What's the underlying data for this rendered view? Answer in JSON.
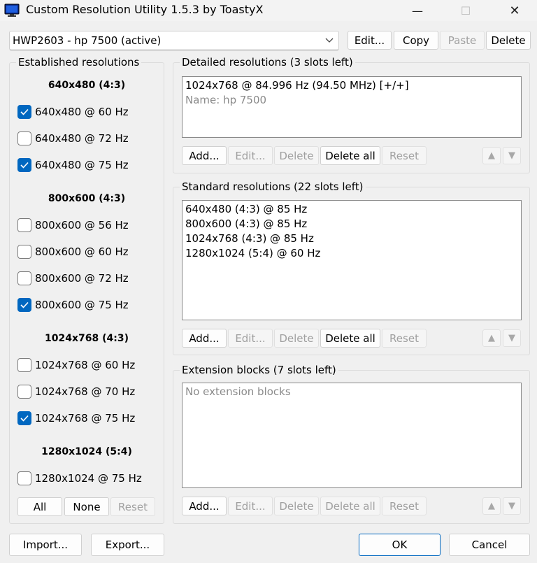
{
  "window": {
    "title": "Custom Resolution Utility 1.5.3 by ToastyX",
    "minimize_glyph": "—",
    "maximize_glyph": "☐",
    "close_glyph": "✕"
  },
  "display_select": {
    "value": "HWP2603 - hp 7500 (active)",
    "icon": "chevron-down-icon"
  },
  "top_buttons": {
    "edit": "Edit...",
    "copy": "Copy",
    "paste": "Paste",
    "delete": "Delete"
  },
  "established": {
    "title": "Established resolutions",
    "groups": [
      {
        "heading": "640x480 (4:3)",
        "items": [
          {
            "label": "640x480 @ 60 Hz",
            "checked": true
          },
          {
            "label": "640x480 @ 72 Hz",
            "checked": false
          },
          {
            "label": "640x480 @ 75 Hz",
            "checked": true
          }
        ]
      },
      {
        "heading": "800x600 (4:3)",
        "items": [
          {
            "label": "800x600 @ 56 Hz",
            "checked": false
          },
          {
            "label": "800x600 @ 60 Hz",
            "checked": false
          },
          {
            "label": "800x600 @ 72 Hz",
            "checked": false
          },
          {
            "label": "800x600 @ 75 Hz",
            "checked": true
          }
        ]
      },
      {
        "heading": "1024x768 (4:3)",
        "items": [
          {
            "label": "1024x768 @ 60 Hz",
            "checked": false
          },
          {
            "label": "1024x768 @ 70 Hz",
            "checked": false
          },
          {
            "label": "1024x768 @ 75 Hz",
            "checked": true
          }
        ]
      },
      {
        "heading": "1280x1024 (5:4)",
        "items": [
          {
            "label": "1280x1024 @ 75 Hz",
            "checked": false
          }
        ]
      }
    ],
    "buttons": {
      "all": "All",
      "none": "None",
      "reset": "Reset"
    }
  },
  "detailed": {
    "title": "Detailed resolutions (3 slots left)",
    "entries": [
      "1024x768 @ 84.996 Hz (94.50 MHz) [+/+]"
    ],
    "name_line": "Name: hp 7500",
    "buttons": {
      "add": "Add...",
      "edit": "Edit...",
      "delete": "Delete",
      "delete_all": "Delete all",
      "reset": "Reset"
    }
  },
  "standard": {
    "title": "Standard resolutions (22 slots left)",
    "entries": [
      "640x480 (4:3) @ 85 Hz",
      "800x600 (4:3) @ 85 Hz",
      "1024x768 (4:3) @ 85 Hz",
      "1280x1024 (5:4) @ 60 Hz"
    ],
    "buttons": {
      "add": "Add...",
      "edit": "Edit...",
      "delete": "Delete",
      "delete_all": "Delete all",
      "reset": "Reset"
    }
  },
  "extension": {
    "title": "Extension blocks (7 slots left)",
    "empty_text": "No extension blocks",
    "buttons": {
      "add": "Add...",
      "edit": "Edit...",
      "delete": "Delete",
      "delete_all": "Delete all",
      "reset": "Reset"
    }
  },
  "footer": {
    "import": "Import...",
    "export": "Export...",
    "ok": "OK",
    "cancel": "Cancel"
  },
  "colors": {
    "accent": "#0067c0",
    "window_bg": "#f0f0f0",
    "disabled_text": "#a0a0a0"
  }
}
